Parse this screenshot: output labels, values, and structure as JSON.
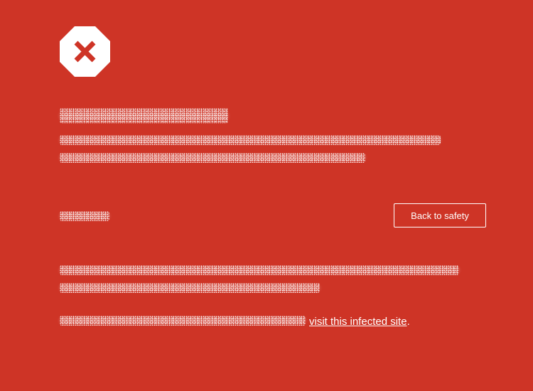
{
  "icon": {
    "name": "stop-x-icon",
    "octagon_color": "#ffffff",
    "x_color": "#ce3426"
  },
  "colors": {
    "background": "#ce3426",
    "text": "#ffffff"
  },
  "main": {
    "safety_button_label": "Back to safety",
    "visit_link_label": "visit this infected site",
    "visit_link_suffix": "."
  }
}
